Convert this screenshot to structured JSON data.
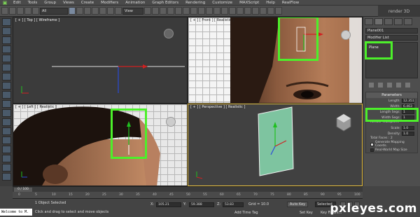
{
  "menubar": {
    "items": [
      "Edit",
      "Tools",
      "Group",
      "Views",
      "Create",
      "Modifiers",
      "Animation",
      "Graph Editors",
      "Rendering",
      "Customize",
      "MAXScript",
      "Help",
      "RealFlow"
    ]
  },
  "toolbar": {
    "filter_value": "All",
    "coord_value": "View",
    "render_label": "render 3D"
  },
  "viewports": {
    "top_label": "[ + ] [ Top ] [ Wireframe ]",
    "front_label": "[ + ] [ Front ] [ Realistic ]",
    "left_label": "[ + ] [ Left ] [ Realistic ]",
    "persp_label": "[ + ] [ Perspective ] [ Realistic ]"
  },
  "command_panel": {
    "object_name": "Plane001",
    "modifier_list": "Modifier List",
    "stack_item": "Plane",
    "rollout_title": "Parameters",
    "length_label": "Length:",
    "length_value": "12.351",
    "width_label": "Width:",
    "width_value": "6.463",
    "length_segs_label": "Length Segs:",
    "length_segs_value": "1",
    "width_segs_label": "Width Segs:",
    "width_segs_value": "1",
    "render_multipliers": "Render Multipliers",
    "scale_label": "Scale:",
    "scale_value": "1.0",
    "density_label": "Density:",
    "density_value": "1.0",
    "total_faces": "Total Faces : 2",
    "gen_mapping": "Generate Mapping Coords.",
    "real_world": "Real-World Map Size"
  },
  "timeline": {
    "slider": "0 / 100",
    "ticks": [
      "0",
      "5",
      "10",
      "15",
      "20",
      "25",
      "30",
      "35",
      "40",
      "45",
      "50",
      "55",
      "60",
      "65",
      "70",
      "75",
      "80",
      "85",
      "90",
      "95",
      "100"
    ]
  },
  "statusbar": {
    "welcome": "Welcome to M.",
    "selected": "1 Object Selected",
    "hint": "Click and drag to select and move objects",
    "x_label": "X:",
    "x_value": "105.21",
    "y_label": "Y:",
    "y_value": "59.388",
    "z_label": "Z:",
    "z_value": "53.83",
    "grid": "Grid = 10.0",
    "add_time_tag": "Add Time Tag",
    "auto_key": "Auto Key",
    "set_key": "Set Key",
    "selected_dropdown": "Selected",
    "key_filters": "Key Filters...",
    "watermark": "pxleyes.com"
  }
}
